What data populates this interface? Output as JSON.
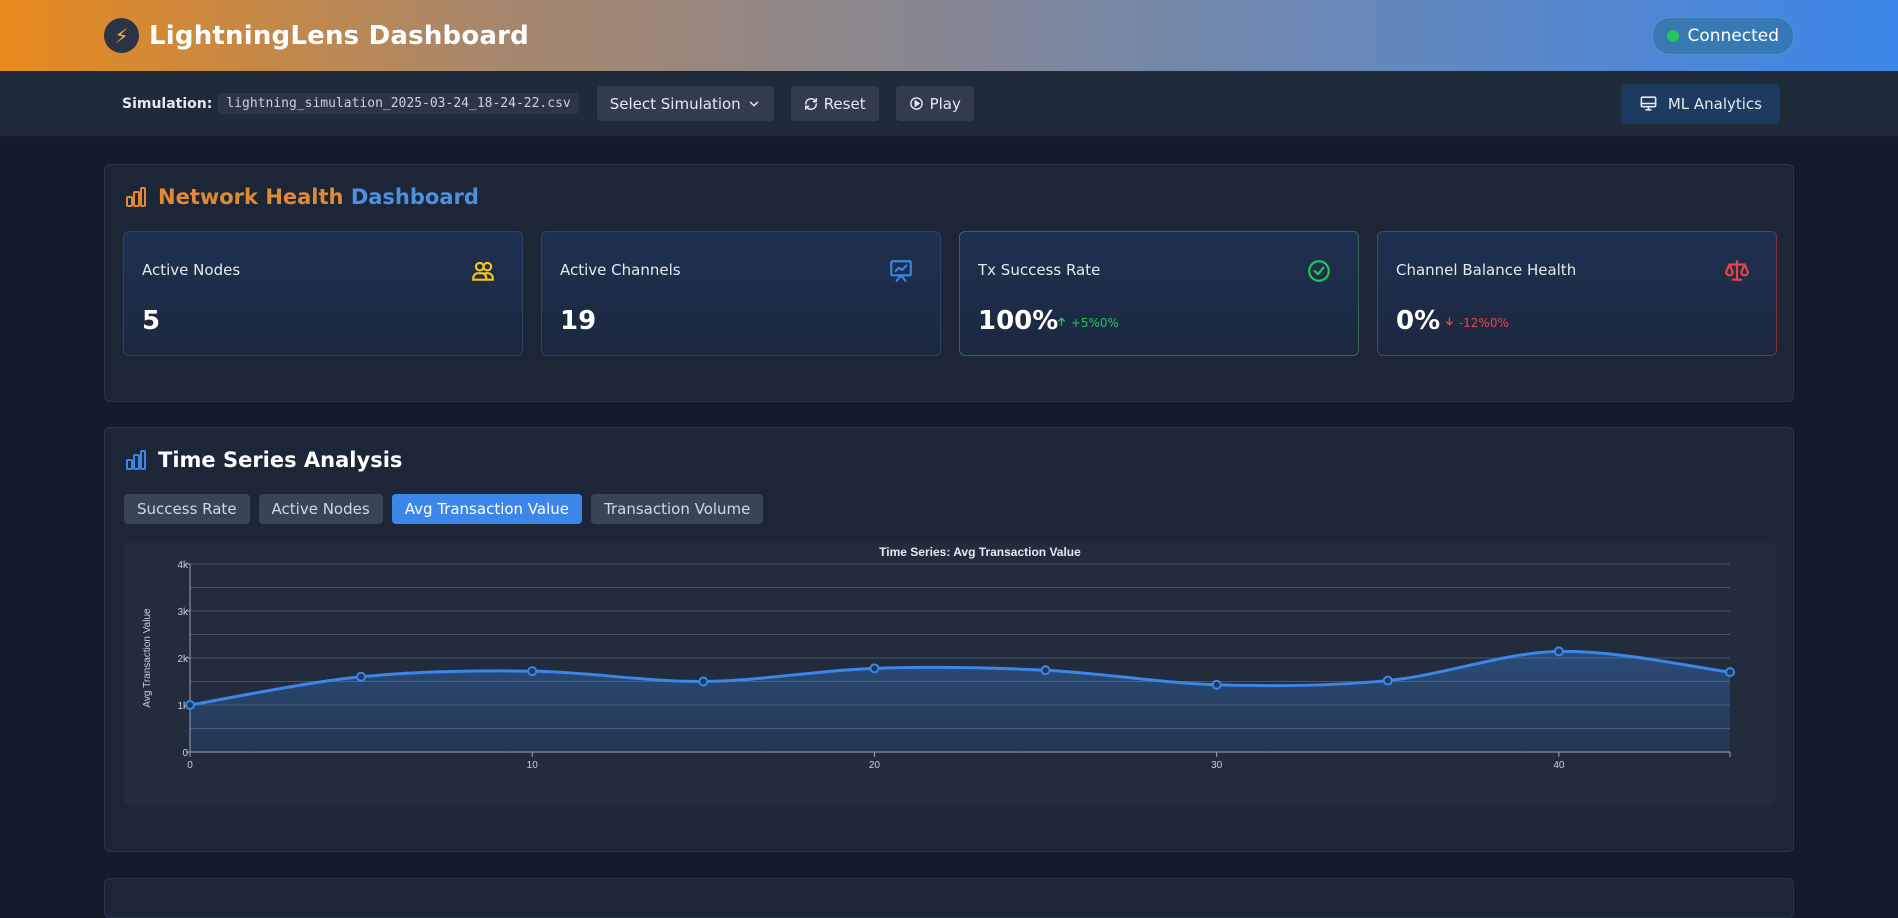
{
  "header": {
    "title": "LightningLens Dashboard",
    "status": "Connected"
  },
  "toolbar": {
    "simulation_label": "Simulation:",
    "simulation_file": "lightning_simulation_2025-03-24_18-24-22.csv",
    "select_simulation": "Select Simulation",
    "reset": "Reset",
    "play": "Play",
    "ml_analytics": "ML Analytics"
  },
  "health": {
    "title_part1": "Network Health",
    "title_part2": "Dashboard",
    "cards": [
      {
        "label": "Active Nodes",
        "value": "5",
        "icon": "users-icon",
        "icon_color": "#f5c518"
      },
      {
        "label": "Active Channels",
        "value": "19",
        "icon": "presentation-chart-icon",
        "icon_color": "#3b86e8"
      },
      {
        "label": "Tx Success Rate",
        "value": "100%",
        "delta": "+5%0%",
        "icon": "check-circle-icon",
        "icon_color": "#22c55e"
      },
      {
        "label": "Channel Balance Health",
        "value": "0%",
        "delta": "-12%0%",
        "icon": "scale-icon",
        "icon_color": "#ef4444"
      }
    ]
  },
  "time_series": {
    "title": "Time Series Analysis",
    "tabs": [
      "Success Rate",
      "Active Nodes",
      "Avg Transaction Value",
      "Transaction Volume"
    ],
    "active_tab": "Avg Transaction Value"
  },
  "chart_data": {
    "type": "area",
    "title": "Time Series: Avg Transaction Value",
    "xlabel": "",
    "ylabel": "Avg Transaction Value",
    "x": [
      0,
      5,
      10,
      15,
      20,
      25,
      30,
      35,
      40,
      45
    ],
    "series": [
      {
        "values": [
          1000,
          1600,
          1720,
          1500,
          1780,
          1740,
          1430,
          1520,
          2140,
          1700
        ]
      }
    ],
    "xlim": [
      0,
      45
    ],
    "ylim": [
      0,
      4000
    ],
    "x_ticks": [
      "0",
      "10",
      "20",
      "30",
      "40"
    ],
    "y_ticks": [
      "0",
      "1k",
      "2k",
      "3k",
      "4k"
    ],
    "grid": true,
    "line_color": "#3b86e8"
  }
}
